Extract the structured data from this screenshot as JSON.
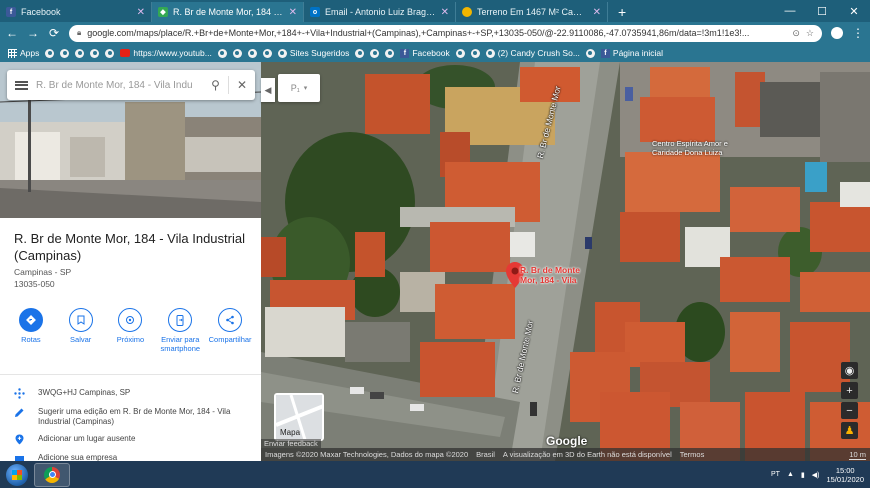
{
  "tabs": [
    {
      "label": "Facebook",
      "icon": "facebook-icon",
      "color": "#3b5998",
      "active": false
    },
    {
      "label": "R. Br de Monte Mor, 184 - Vila In",
      "icon": "google-maps-icon",
      "color": "#34a853",
      "active": true
    },
    {
      "label": "Email - Antonio Luiz Braga - Out",
      "icon": "outlook-icon",
      "color": "#0072c6",
      "active": false
    },
    {
      "label": "Terreno Em 1467 M² Campinas S",
      "icon": "listing-icon",
      "color": "#f2b600",
      "active": false
    }
  ],
  "new_tab": "+",
  "window_controls": {
    "minimize": "—",
    "maximize": "☐",
    "close": "✕"
  },
  "toolbar": {
    "back": "←",
    "forward": "→",
    "reload": "⟳",
    "url": "google.com/maps/place/R.+Br+de+Monte+Mor,+184+-+Vila+Industrial+(Campinas),+Campinas+-+SP,+13035-050/@-22.9110086,-47.0735941,86m/data=!3m1!1e3!..."
  },
  "bookmarks": [
    {
      "label": "Apps",
      "icon": "apps-grid-icon"
    },
    {
      "label": "",
      "icon": "bookmark-dot-icon"
    },
    {
      "label": "",
      "icon": "bookmark-dot-icon"
    },
    {
      "label": "",
      "icon": "bookmark-dot-icon"
    },
    {
      "label": "",
      "icon": "bookmark-dot-icon"
    },
    {
      "label": "",
      "icon": "bookmark-dot-icon"
    },
    {
      "label": "https://www.youtub...",
      "icon": "youtube-icon"
    },
    {
      "label": "",
      "icon": "bookmark-dot-icon"
    },
    {
      "label": "",
      "icon": "bookmark-dot-icon"
    },
    {
      "label": "",
      "icon": "bookmark-dot-icon"
    },
    {
      "label": "",
      "icon": "bookmark-dot-icon"
    },
    {
      "label": "Sites Sugeridos",
      "icon": "bookmark-dot-icon"
    },
    {
      "label": "",
      "icon": "bookmark-dot-icon"
    },
    {
      "label": "",
      "icon": "bookmark-dot-icon"
    },
    {
      "label": "",
      "icon": "bookmark-dot-icon"
    },
    {
      "label": "Facebook",
      "icon": "facebook-icon"
    },
    {
      "label": "",
      "icon": "bookmark-dot-icon"
    },
    {
      "label": "",
      "icon": "bookmark-dot-icon"
    },
    {
      "label": "(2) Candy Crush So...",
      "icon": "bookmark-dot-icon"
    },
    {
      "label": "",
      "icon": "bookmark-dot-icon"
    },
    {
      "label": "Página inicial",
      "icon": "facebook-icon"
    }
  ],
  "search": {
    "query": "R. Br de Monte Mor, 184 - Vila Indu"
  },
  "place": {
    "title": "R. Br de Monte Mor, 184 - Vila Industrial (Campinas)",
    "city": "Campinas - SP",
    "zip": "13035-050"
  },
  "actions": [
    {
      "label": "Rotas",
      "icon": "directions-icon"
    },
    {
      "label": "Salvar",
      "icon": "bookmark-icon"
    },
    {
      "label": "Próximo",
      "icon": "nearby-icon"
    },
    {
      "label": "Enviar para smartphone",
      "icon": "send-to-phone-icon"
    },
    {
      "label": "Compartilhar",
      "icon": "share-icon"
    }
  ],
  "info": [
    {
      "label": "3WQG+HJ Campinas, SP",
      "icon": "plus-code-icon"
    },
    {
      "label": "Sugerir uma edição em R. Br de Monte Mor, 184 - Vila Industrial (Campinas)",
      "icon": "edit-icon"
    },
    {
      "label": "Adicionar um lugar ausente",
      "icon": "add-place-icon"
    },
    {
      "label": "Adicione sua empresa",
      "icon": "business-icon"
    }
  ],
  "map": {
    "pin_label": "R. Br de Monte Mor, 184 - Vila",
    "poi_label": "Centro Espírita Amor e Caridade Dona Luiza",
    "street_1": "R. Br de Monte Mor",
    "street_2": "R. Br de Monte Mor",
    "layer_label": "Mapa",
    "google_logo": "Google",
    "selector_text": "P₁",
    "footer_items": [
      "Imagens ©2020 Maxar Technologies, Dados do mapa ©2020",
      "Brasil",
      "A visualização em 3D do Earth não está disponível",
      "Termos",
      "10 m"
    ],
    "feedback": "Enviar feedback"
  },
  "taskbar": {
    "time": "15:00",
    "date": "15/01/2020",
    "lang": "PT"
  }
}
